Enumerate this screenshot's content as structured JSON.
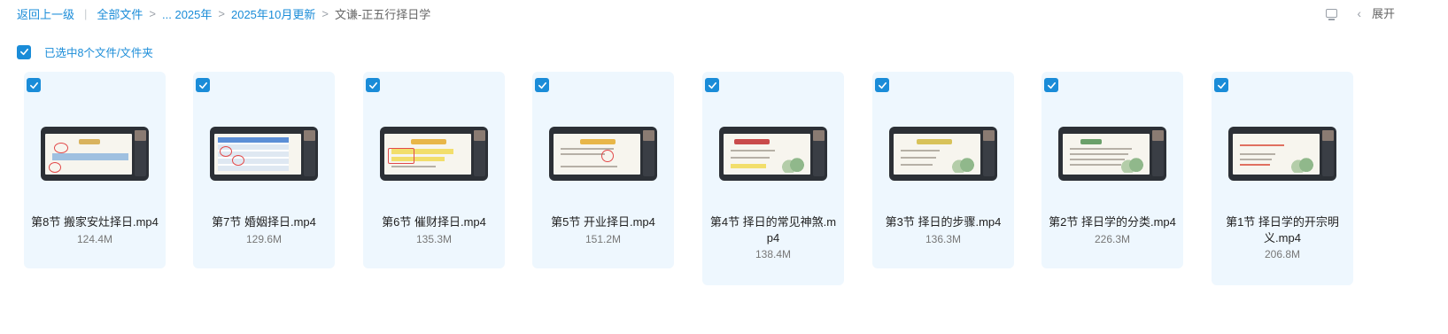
{
  "breadcrumb": {
    "back": "返回上一级",
    "all_files": "全部文件",
    "ellipsis_year": "... 2025年",
    "month": "2025年10月更新",
    "current": "文谦-正五行择日学"
  },
  "top_right": {
    "expand_label": "展开",
    "icons": [
      "screen-icon",
      "chevron-left-icon"
    ]
  },
  "selection": {
    "label": "已选中8个文件/文件夹"
  },
  "accent_color": "#1a8cd8",
  "files": [
    {
      "name": "第8节 搬家安灶择日.mp4",
      "size": "124.4M"
    },
    {
      "name": "第7节 婚姻择日.mp4",
      "size": "129.6M"
    },
    {
      "name": "第6节 催财择日.mp4",
      "size": "135.3M"
    },
    {
      "name": "第5节 开业择日.mp4",
      "size": "151.2M"
    },
    {
      "name": "第4节 择日的常见神煞.mp4",
      "size": "138.4M"
    },
    {
      "name": "第3节 择日的步骤.mp4",
      "size": "136.3M"
    },
    {
      "name": "第2节 择日学的分类.mp4",
      "size": "226.3M"
    },
    {
      "name": "第1节 择日学的开宗明义.mp4",
      "size": "206.8M"
    }
  ]
}
